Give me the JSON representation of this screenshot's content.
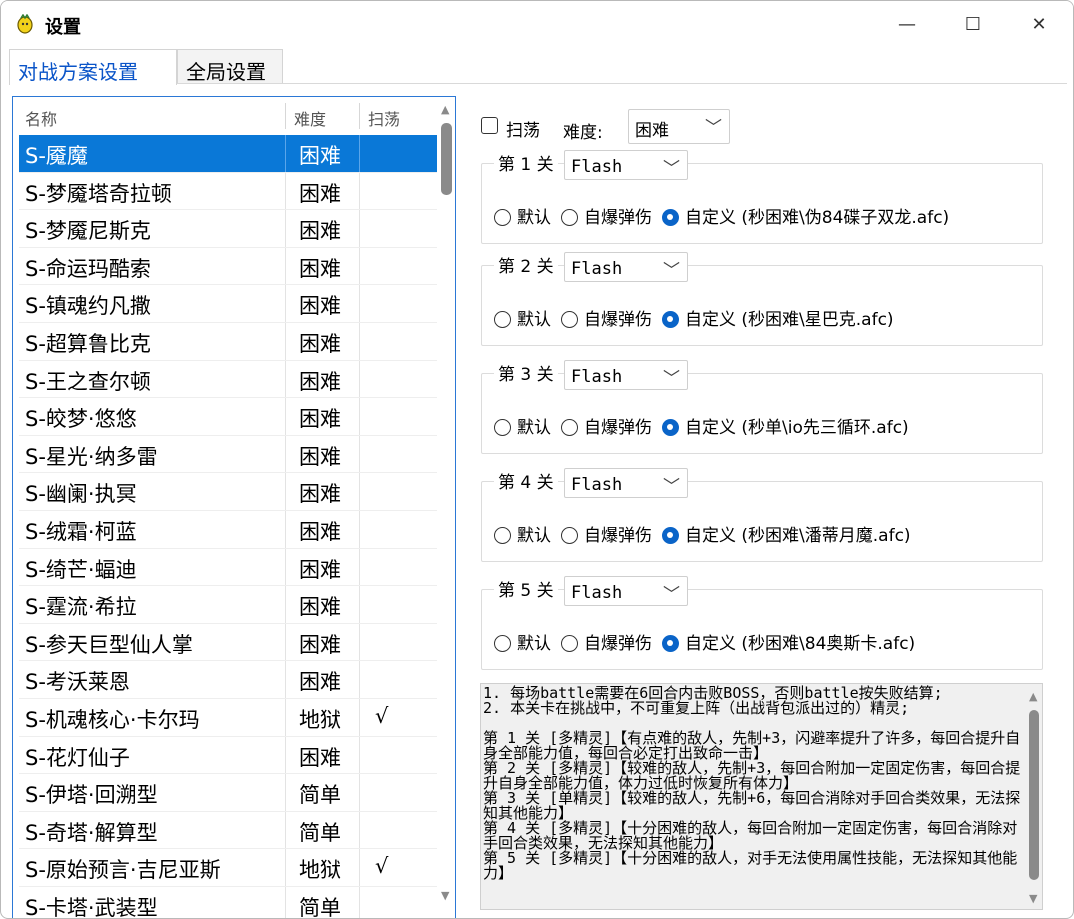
{
  "window": {
    "title": "设置",
    "min_glyph": "—",
    "max_glyph": "☐",
    "close_glyph": "✕"
  },
  "tabs": [
    {
      "label": "对战方案设置",
      "active": true
    },
    {
      "label": "全局设置",
      "active": false
    }
  ],
  "list": {
    "headers": {
      "name": "名称",
      "difficulty": "难度",
      "sweep": "扫荡"
    },
    "rows": [
      {
        "name": "S-魇魔",
        "difficulty": "困难",
        "sweep": "",
        "selected": true
      },
      {
        "name": "S-梦魇塔奇拉顿",
        "difficulty": "困难",
        "sweep": ""
      },
      {
        "name": "S-梦魇尼斯克",
        "difficulty": "困难",
        "sweep": ""
      },
      {
        "name": "S-命运玛酷索",
        "difficulty": "困难",
        "sweep": ""
      },
      {
        "name": "S-镇魂约凡撒",
        "difficulty": "困难",
        "sweep": ""
      },
      {
        "name": "S-超算鲁比克",
        "difficulty": "困难",
        "sweep": ""
      },
      {
        "name": "S-王之查尔顿",
        "difficulty": "困难",
        "sweep": ""
      },
      {
        "name": "S-皎梦·悠悠",
        "difficulty": "困难",
        "sweep": ""
      },
      {
        "name": "S-星光·纳多雷",
        "difficulty": "困难",
        "sweep": ""
      },
      {
        "name": "S-幽阑·执冥",
        "difficulty": "困难",
        "sweep": ""
      },
      {
        "name": "S-绒霜·柯蓝",
        "difficulty": "困难",
        "sweep": ""
      },
      {
        "name": "S-绮芒·蝠迪",
        "difficulty": "困难",
        "sweep": ""
      },
      {
        "name": "S-霆流·希拉",
        "difficulty": "困难",
        "sweep": ""
      },
      {
        "name": "S-参天巨型仙人掌",
        "difficulty": "困难",
        "sweep": ""
      },
      {
        "name": "S-考沃莱恩",
        "difficulty": "困难",
        "sweep": ""
      },
      {
        "name": "S-机魂核心·卡尔玛",
        "difficulty": "地狱",
        "sweep": "√"
      },
      {
        "name": "S-花灯仙子",
        "difficulty": "困难",
        "sweep": ""
      },
      {
        "name": "S-伊塔·回溯型",
        "difficulty": "简单",
        "sweep": ""
      },
      {
        "name": "S-奇塔·解算型",
        "difficulty": "简单",
        "sweep": ""
      },
      {
        "name": "S-原始预言·吉尼亚斯",
        "difficulty": "地狱",
        "sweep": "√"
      },
      {
        "name": "S-卡塔·武装型",
        "difficulty": "简单",
        "sweep": ""
      }
    ]
  },
  "panel": {
    "sweep_label": "扫荡",
    "sweep_checked": false,
    "difficulty_label": "难度:",
    "difficulty_value": "困难",
    "chevron": "﹀",
    "radio_labels": {
      "default": "默认",
      "self_destruct": "自爆弹伤",
      "custom": "自定义"
    },
    "stages": [
      {
        "title": "第 1 关",
        "mode": "Flash",
        "selected": "custom",
        "script": "(秒困难\\伪84碟子双龙.afc)"
      },
      {
        "title": "第 2 关",
        "mode": "Flash",
        "selected": "custom",
        "script": "(秒困难\\星巴克.afc)"
      },
      {
        "title": "第 3 关",
        "mode": "Flash",
        "selected": "custom",
        "script": "(秒单\\io先三循环.afc)"
      },
      {
        "title": "第 4 关",
        "mode": "Flash",
        "selected": "custom",
        "script": "(秒困难\\潘蒂月魔.afc)"
      },
      {
        "title": "第 5 关",
        "mode": "Flash",
        "selected": "custom",
        "script": "(秒困难\\84奥斯卡.afc)"
      }
    ],
    "notes": "1. 每场battle需要在6回合内击败BOSS，否则battle按失败结算;\n2. 本关卡在挑战中，不可重复上阵（出战背包派出过的）精灵;\n\n第 1 关 [多精灵]【有点难的敌人，先制+3，闪避率提升了许多，每回合提升自身全部能力值，每回合必定打出致命一击】\n第 2 关 [多精灵]【较难的敌人，先制+3，每回合附加一定固定伤害，每回合提升自身全部能力值，体力过低时恢复所有体力】\n第 3 关 [单精灵]【较难的敌人，先制+6，每回合消除对手回合类效果，无法探知其他能力】\n第 4 关 [多精灵]【十分困难的敌人，每回合附加一定固定伤害，每回合消除对手回合类效果，无法探知其他能力】\n第 5 关 [多精灵]【十分困难的敌人，对手无法使用属性技能，无法探知其他能力】"
  }
}
